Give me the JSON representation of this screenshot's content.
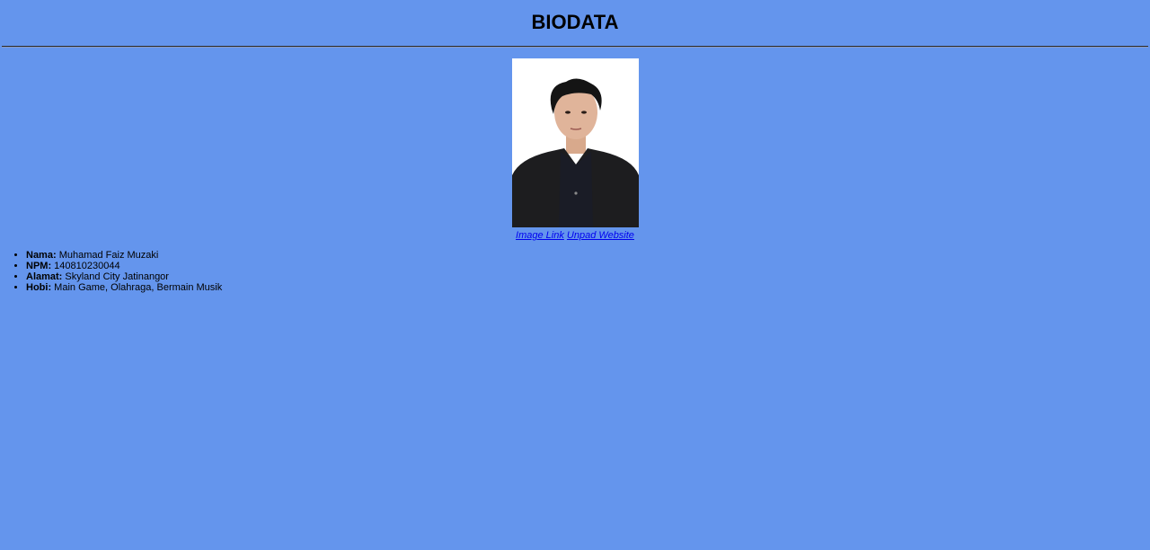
{
  "page": {
    "title": "BIODATA",
    "background": "#6495ED"
  },
  "photo": {
    "description_icon": "portrait-photo",
    "links": [
      {
        "label": "Image Link"
      },
      {
        "label": "Unpad Website"
      }
    ]
  },
  "bio": {
    "items": [
      {
        "key": "Nama:",
        "value": "Muhamad Faiz Muzaki"
      },
      {
        "key": "NPM:",
        "value": "140810230044"
      },
      {
        "key": "Alamat:",
        "value": "Skyland City Jatinangor"
      },
      {
        "key": "Hobi:",
        "value": "Main Game, Olahraga, Bermain Musik"
      }
    ]
  },
  "colors": {
    "link": "#0000EE",
    "text": "#000000"
  }
}
